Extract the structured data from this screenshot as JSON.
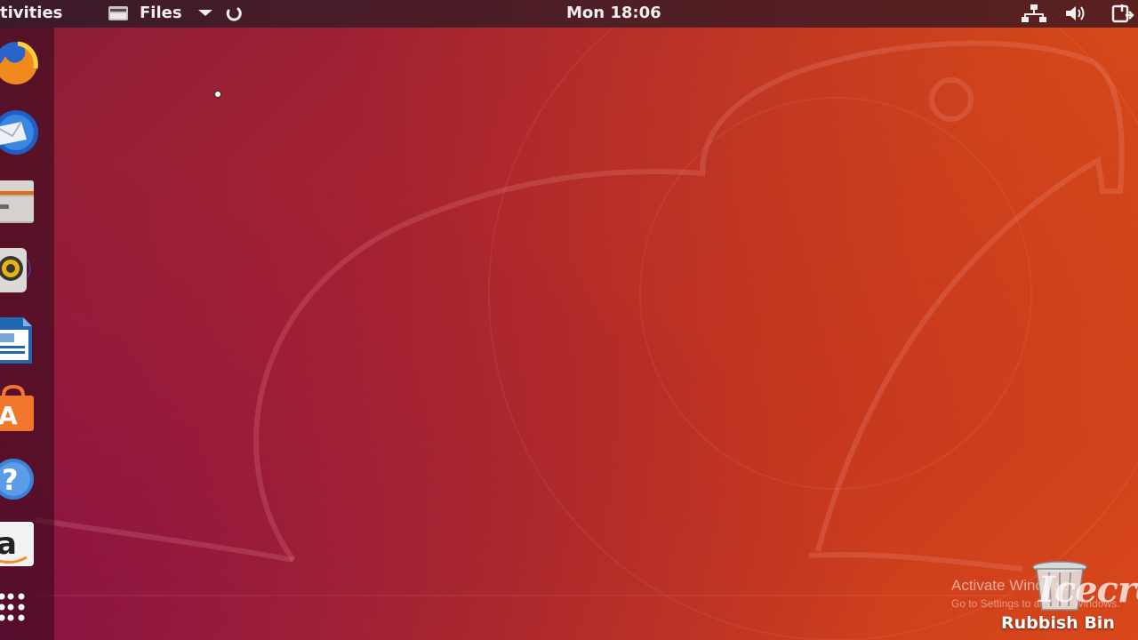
{
  "topbar": {
    "activities_label": "tivities",
    "app_menu_label": "Files",
    "clock": "Mon 18:06"
  },
  "dock": {
    "items": [
      {
        "name": "Firefox Web Browser",
        "icon": "firefox-icon"
      },
      {
        "name": "Thunderbird Mail",
        "icon": "thunderbird-icon"
      },
      {
        "name": "Files",
        "icon": "files-icon"
      },
      {
        "name": "Rhythmbox",
        "icon": "rhythmbox-icon"
      },
      {
        "name": "LibreOffice Writer",
        "icon": "writer-icon"
      },
      {
        "name": "Ubuntu Software",
        "icon": "software-icon"
      },
      {
        "name": "Help",
        "icon": "help-icon"
      },
      {
        "name": "Amazon",
        "icon": "amazon-icon"
      },
      {
        "name": "Show Applications",
        "icon": "app-grid-icon"
      }
    ]
  },
  "desktop": {
    "trash_label": "Rubbish Bin",
    "activation_title": "Activate Windows",
    "activation_sub": "Go to Settings to activate Windows.",
    "watermark": "Icecre"
  },
  "colors": {
    "accent": "#e95420",
    "topbar_text": "#f3eeee"
  }
}
